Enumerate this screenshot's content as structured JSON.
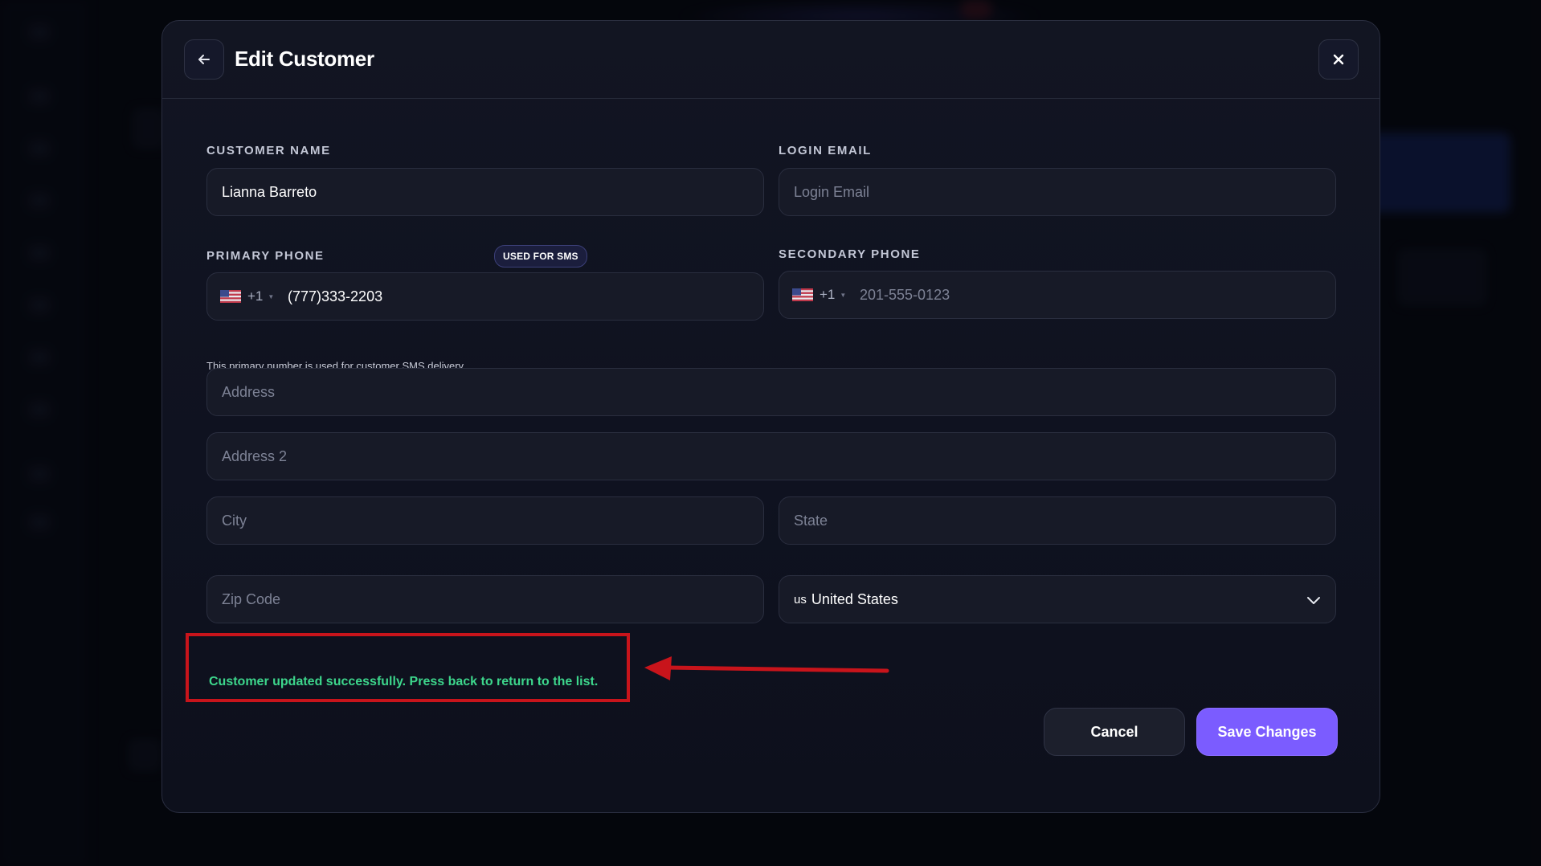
{
  "modal": {
    "title": "Edit Customer"
  },
  "form": {
    "customer_name": {
      "label": "CUSTOMER NAME",
      "value": "Lianna Barreto",
      "placeholder": "Customer Name"
    },
    "login_email": {
      "label": "LOGIN EMAIL",
      "value": "",
      "placeholder": "Login Email"
    },
    "primary_phone": {
      "label": "PRIMARY PHONE",
      "badge": "USED FOR SMS",
      "country_code": "+1",
      "value": "(777)333-2203",
      "helper": "This primary number is used for customer SMS delivery."
    },
    "secondary_phone": {
      "label": "SECONDARY PHONE",
      "country_code": "+1",
      "value": "",
      "placeholder": "201-555-0123"
    },
    "address": {
      "placeholder": "Address"
    },
    "address2": {
      "placeholder": "Address 2"
    },
    "city": {
      "placeholder": "City"
    },
    "state": {
      "placeholder": "State"
    },
    "zip": {
      "placeholder": "Zip Code"
    },
    "country": {
      "code": "us",
      "value": "United States"
    }
  },
  "status": {
    "message": "Customer updated successfully. Press back to return to the list.",
    "color": "#3dd68c"
  },
  "actions": {
    "cancel_label": "Cancel",
    "save_label": "Save Changes"
  },
  "colors": {
    "accent": "#7b5cff",
    "annotation": "#c8141b",
    "background": "#0f1220"
  },
  "icons": {
    "back": "arrow-left-icon",
    "close": "close-icon",
    "dropdown": "chevron-down-icon",
    "flag": "us-flag-icon"
  }
}
